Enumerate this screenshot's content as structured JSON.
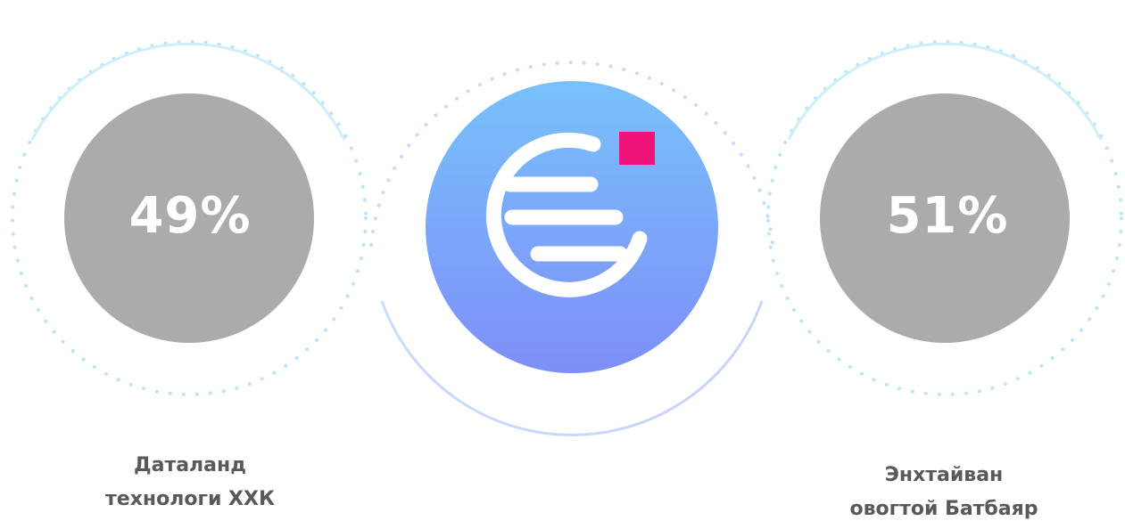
{
  "owners": [
    {
      "share": "49%",
      "name_line1": "Даталанд",
      "name_line2": "технологи ХХК"
    },
    {
      "share": "51%",
      "name_line1": "Энхтайван",
      "name_line2": "овогтой Батбаяр"
    }
  ],
  "icons": {
    "center": "company-logo-icon"
  },
  "colors": {
    "share_circle": "#ababab",
    "logo_gradient_top": "#78c1fb",
    "logo_gradient_bottom": "#7e8ef8",
    "logo_accent_square": "#f0147a",
    "arc_light_blue": "#cdeefa",
    "dot_blue": "#bde4f8",
    "name_text": "#595959"
  }
}
